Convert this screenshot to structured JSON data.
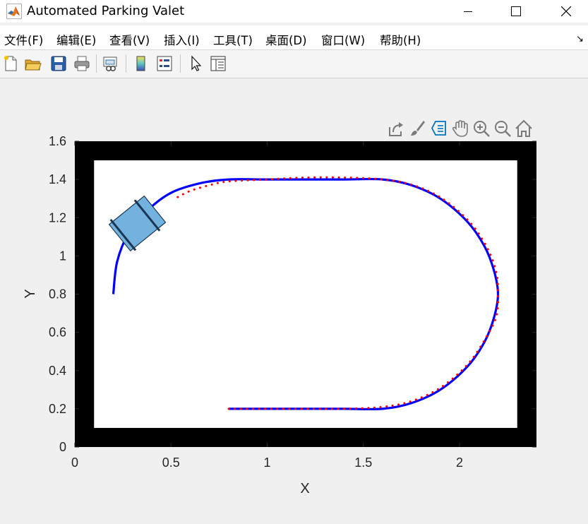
{
  "window": {
    "title": "Automated Parking Valet",
    "app_icon": "matlab-logo-icon",
    "controls": [
      "minimize-icon",
      "maximize-icon",
      "close-icon"
    ]
  },
  "menu": {
    "items": [
      "文件(F)",
      "编辑(E)",
      "查看(V)",
      "插入(I)",
      "工具(T)",
      "桌面(D)",
      "窗口(W)",
      "帮助(H)"
    ],
    "overflow_icon": "dock-arrow-icon"
  },
  "toolbar": {
    "buttons": [
      "new-figure-icon",
      "open-file-icon",
      "save-icon",
      "print-icon",
      "link-plot-icon",
      "colorbar-icon",
      "legend-icon",
      "edit-plot-icon",
      "property-inspector-icon"
    ]
  },
  "axes_toolbar": {
    "buttons": [
      "export-icon",
      "brush-icon",
      "data-tips-icon",
      "pan-icon",
      "zoom-in-icon",
      "zoom-out-icon",
      "home-icon"
    ]
  },
  "colors": {
    "reference_path": "#0000ff",
    "trajectory": "#ff0000",
    "vehicle_fill": "#73b2df",
    "vehicle_edge": "#1a3550",
    "border": "#000000",
    "data_tip_active": "#0072bd"
  },
  "chart_data": {
    "type": "line",
    "title": "",
    "xlabel": "X",
    "ylabel": "Y",
    "xlim": [
      0,
      2.4
    ],
    "ylim": [
      0,
      1.6
    ],
    "xticks": [
      "0",
      "0.5",
      "1",
      "1.5",
      "2"
    ],
    "yticks": [
      "0",
      "0.2",
      "0.4",
      "0.6",
      "0.8",
      "1",
      "1.2",
      "1.4",
      "1.6"
    ],
    "grid": false,
    "legend": "none",
    "occupancy_border": {
      "outer": [
        0,
        2.4,
        0,
        1.6
      ],
      "inner": [
        0.1,
        2.3,
        0.1,
        1.5
      ]
    },
    "series": [
      {
        "style": "solid",
        "points": [
          [
            0.8,
            0.2
          ],
          [
            1.0,
            0.2
          ],
          [
            1.2,
            0.2
          ],
          [
            1.4,
            0.2
          ],
          [
            1.6,
            0.2
          ],
          [
            1.75,
            0.23
          ],
          [
            1.9,
            0.3
          ],
          [
            2.04,
            0.42
          ],
          [
            2.13,
            0.55
          ],
          [
            2.18,
            0.68
          ],
          [
            2.2,
            0.8
          ],
          [
            2.18,
            0.92
          ],
          [
            2.13,
            1.05
          ],
          [
            2.04,
            1.18
          ],
          [
            1.9,
            1.3
          ],
          [
            1.75,
            1.37
          ],
          [
            1.6,
            1.4
          ],
          [
            1.4,
            1.4
          ],
          [
            1.2,
            1.4
          ],
          [
            1.0,
            1.4
          ],
          [
            0.8,
            1.4
          ],
          [
            0.65,
            1.38
          ],
          [
            0.5,
            1.33
          ],
          [
            0.38,
            1.24
          ],
          [
            0.28,
            1.12
          ],
          [
            0.22,
            0.97
          ],
          [
            0.2,
            0.8
          ]
        ]
      },
      {
        "style": "dotted",
        "points": [
          [
            0.8,
            0.2
          ],
          [
            1.0,
            0.2
          ],
          [
            1.2,
            0.2
          ],
          [
            1.4,
            0.2
          ],
          [
            1.6,
            0.21
          ],
          [
            1.75,
            0.24
          ],
          [
            1.9,
            0.31
          ],
          [
            2.04,
            0.43
          ],
          [
            2.13,
            0.56
          ],
          [
            2.19,
            0.68
          ],
          [
            2.2,
            0.8
          ],
          [
            2.19,
            0.92
          ],
          [
            2.14,
            1.05
          ],
          [
            2.05,
            1.18
          ],
          [
            1.91,
            1.3
          ],
          [
            1.76,
            1.37
          ],
          [
            1.6,
            1.4
          ],
          [
            1.4,
            1.41
          ],
          [
            1.2,
            1.41
          ],
          [
            1.0,
            1.4
          ],
          [
            0.8,
            1.39
          ],
          [
            0.7,
            1.37
          ],
          [
            0.6,
            1.34
          ],
          [
            0.52,
            1.3
          ]
        ]
      }
    ],
    "vehicle": {
      "x": 0.325,
      "y": 1.17,
      "heading_deg": -39
    }
  }
}
